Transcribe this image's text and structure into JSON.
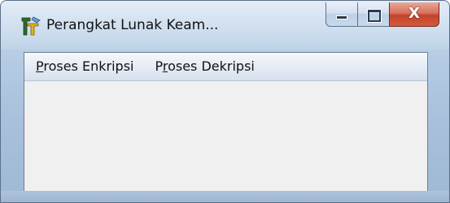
{
  "window": {
    "title": "Perangkat Lunak Keam...",
    "app_icon": "app-tool-icon",
    "caption_buttons": {
      "minimize": "minimize-icon",
      "maximize": "maximize-icon",
      "close": "close-icon",
      "close_glyph": "X"
    }
  },
  "menubar": {
    "items": [
      {
        "mnemonic": "P",
        "rest": "roses Enkripsi"
      },
      {
        "prefix": "P",
        "mnemonic": "r",
        "rest": "oses Dekripsi"
      }
    ]
  },
  "colors": {
    "frame": "#b4cbe3",
    "client_bg": "#f0f0f0",
    "close_button": "#c2432d"
  }
}
